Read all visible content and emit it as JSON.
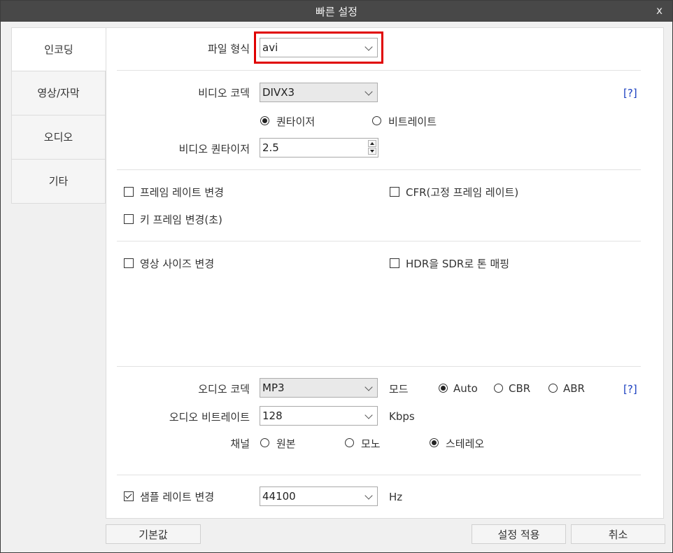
{
  "window": {
    "title": "빠른 설정",
    "close_label": "x"
  },
  "sidebar": {
    "tabs": [
      {
        "label": "인코딩"
      },
      {
        "label": "영상/자막"
      },
      {
        "label": "오디오"
      },
      {
        "label": "기타"
      }
    ]
  },
  "file_format": {
    "label": "파일 형식",
    "value": "avi"
  },
  "video": {
    "codec_label": "비디오 코덱",
    "codec_value": "DIVX3",
    "help": "[?]",
    "mode_quantizer": "퀀타이저",
    "mode_bitrate": "비트레이트",
    "mode_selected": "퀀타이저",
    "quantizer_label": "비디오 퀀타이저",
    "quantizer_value": "2.5"
  },
  "options": {
    "framerate_change": "프레임 레이트 변경",
    "cfr": "CFR(고정 프레임 레이트)",
    "keyframe_change": "키 프레임 변경(초)",
    "size_change": "영상 사이즈 변경",
    "hdr_to_sdr": "HDR을 SDR로 톤 매핑"
  },
  "audio": {
    "codec_label": "오디오 코덱",
    "codec_value": "MP3",
    "mode_label": "모드",
    "modes": [
      "Auto",
      "CBR",
      "ABR"
    ],
    "mode_selected": "Auto",
    "help": "[?]",
    "bitrate_label": "오디오 비트레이트",
    "bitrate_value": "128",
    "bitrate_unit": "Kbps",
    "channel_label": "채널",
    "channels": [
      "원본",
      "모노",
      "스테레오"
    ],
    "channel_selected": "스테레오",
    "samplerate_change_label": "샘플 레이트 변경",
    "samplerate_change_checked": true,
    "samplerate_value": "44100",
    "samplerate_unit": "Hz"
  },
  "footer": {
    "default_button": "기본값",
    "apply_button": "설정 적용",
    "cancel_button": "취소"
  },
  "colors": {
    "highlight": "#e00000",
    "help_link": "#1a3fc0",
    "titlebar": "#484848"
  }
}
